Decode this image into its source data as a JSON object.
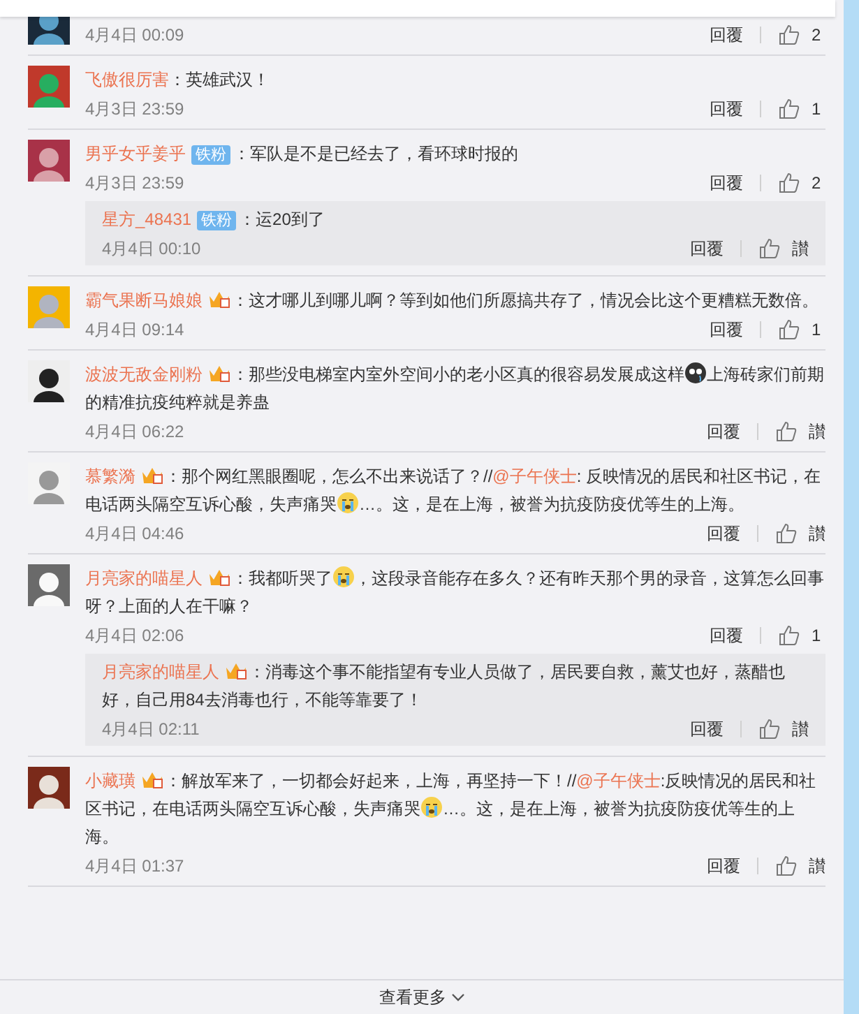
{
  "comments": [
    {
      "time": "4月4日 00:09",
      "reply": "回覆",
      "likes": "2"
    },
    {
      "user": "飞傲很厉害",
      "content": [
        {
          "kind": "text",
          "text": "：英雄武汉！"
        }
      ],
      "time": "4月3日 23:59",
      "reply": "回覆",
      "likes": "1"
    },
    {
      "user": "男乎女乎姜乎",
      "badge": {
        "kind": "fan",
        "label": "铁粉"
      },
      "content": [
        {
          "kind": "text",
          "text": "：军队是不是已经去了，看环球时报的"
        }
      ],
      "time": "4月3日 23:59",
      "reply": "回覆",
      "likes": "2",
      "replies": [
        {
          "user": "星方_48431",
          "badge": {
            "kind": "fan",
            "label": "铁粉"
          },
          "content": [
            {
              "kind": "text",
              "text": "：运20到了"
            }
          ],
          "time": "4月4日 00:10",
          "reply": "回覆",
          "likes": "讃"
        }
      ]
    },
    {
      "user": "霸气果断马娘娘",
      "badge": {
        "kind": "crown"
      },
      "content": [
        {
          "kind": "text",
          "text": "：这才哪儿到哪儿啊？等到如他们所愿搞共存了，情况会比这个更糟糕无数倍。"
        }
      ],
      "time": "4月4日 09:14",
      "reply": "回覆",
      "likes": "1"
    },
    {
      "user": "波波无敌金刚粉",
      "badge": {
        "kind": "crown"
      },
      "content": [
        {
          "kind": "text",
          "text": "：那些没电梯室内室外空间小的老小区真的很容易发展成这样"
        },
        {
          "kind": "emoji-dark"
        },
        {
          "kind": "text",
          "text": "上海砖家们前期的精准抗疫纯粹就是养蛊"
        }
      ],
      "time": "4月4日 06:22",
      "reply": "回覆",
      "likes": "讃"
    },
    {
      "user": "慕繁漪",
      "badge": {
        "kind": "crown"
      },
      "content": [
        {
          "kind": "text",
          "text": "：那个网红黑眼圈呢，怎么不出来说话了？//"
        },
        {
          "kind": "mention",
          "text": "@子午侠士"
        },
        {
          "kind": "text",
          "text": ": 反映情况的居民和社区书记，在电话两头隔空互诉心酸，失声痛哭"
        },
        {
          "kind": "emoji-cry"
        },
        {
          "kind": "text",
          "text": "…。这，是在上海，被誉为抗疫防疫优等生的上海。"
        }
      ],
      "time": "4月4日 04:46",
      "reply": "回覆",
      "likes": "讃"
    },
    {
      "user": "月亮家的喵星人",
      "badge": {
        "kind": "crown"
      },
      "content": [
        {
          "kind": "text",
          "text": "：我都听哭了"
        },
        {
          "kind": "emoji-cry"
        },
        {
          "kind": "text",
          "text": "，这段录音能存在多久？还有昨天那个男的录音，这算怎么回事呀？上面的人在干嘛？"
        }
      ],
      "time": "4月4日 02:06",
      "reply": "回覆",
      "likes": "1",
      "replies": [
        {
          "user": "月亮家的喵星人",
          "badge": {
            "kind": "crown"
          },
          "content": [
            {
              "kind": "text",
              "text": "：消毒这个事不能指望有专业人员做了，居民要自救，薰艾也好，蒸醋也好，自己用84去消毒也行，不能等靠要了！"
            }
          ],
          "time": "4月4日 02:11",
          "reply": "回覆",
          "likes": "讃"
        }
      ]
    },
    {
      "user": "小藏璜",
      "badge": {
        "kind": "crown"
      },
      "content": [
        {
          "kind": "text",
          "text": "：解放军来了，一切都会好起来，上海，再坚持一下！//"
        },
        {
          "kind": "mention",
          "text": "@子午侠士"
        },
        {
          "kind": "text",
          "text": ":反映情况的居民和社区书记，在电话两头隔空互诉心酸，失声痛哭"
        },
        {
          "kind": "emoji-cry"
        },
        {
          "kind": "text",
          "text": "…。这，是在上海，被誉为抗疫防疫优等生的上海。"
        }
      ],
      "time": "4月4日 01:37",
      "reply": "回覆",
      "likes": "讃"
    }
  ],
  "more": "查看更多"
}
